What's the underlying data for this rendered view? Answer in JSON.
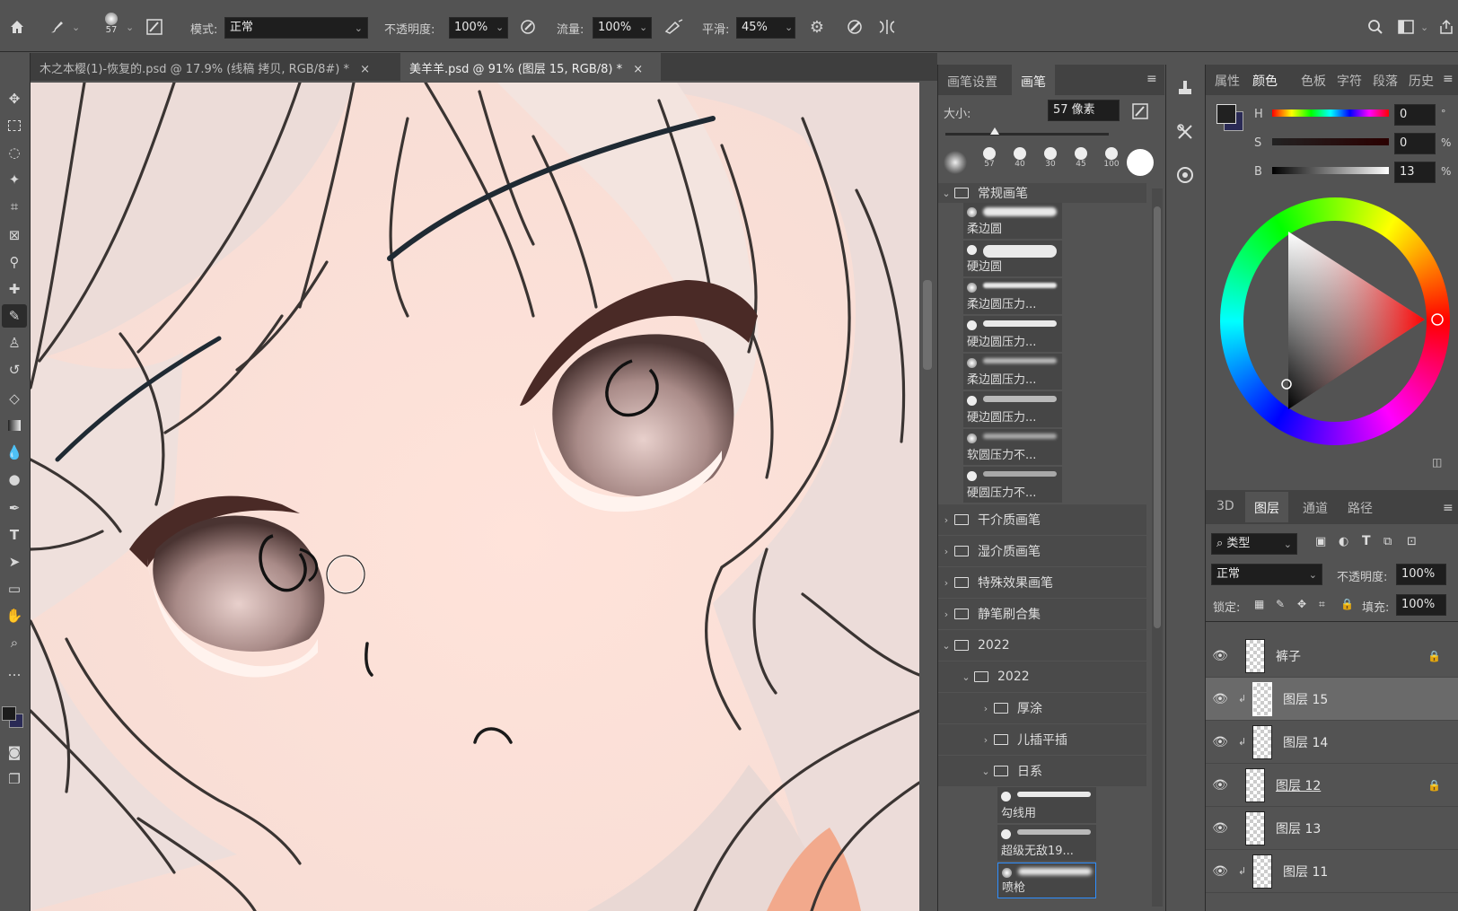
{
  "options_bar": {
    "brush_size": "57",
    "mode_label": "模式:",
    "mode_value": "正常",
    "opacity_label": "不透明度:",
    "opacity_value": "100%",
    "flow_label": "流量:",
    "flow_value": "100%",
    "smooth_label": "平滑:",
    "smooth_value": "45%"
  },
  "tabs": [
    {
      "label": "木之本樱(1)-恢复的.psd @ 17.9% (线稿 拷贝, RGB/8#) *"
    },
    {
      "label": "美羊羊.psd @ 91% (图层 15, RGB/8) *"
    }
  ],
  "brush_panel": {
    "tabs": [
      "画笔设置",
      "画笔"
    ],
    "size_label": "大小:",
    "size_value": "57 像素",
    "presets": [
      "57",
      "40",
      "30",
      "45",
      "100"
    ],
    "group_general": "常规画笔",
    "brushes": [
      "柔边圆",
      "硬边圆",
      "柔边圆压力...",
      "硬边圆压力...",
      "柔边圆压力...",
      "硬边圆压力...",
      "软圆压力不...",
      "硬圆压力不..."
    ],
    "folders": [
      "干介质画笔",
      "湿介质画笔",
      "特殊效果画笔",
      "静笔刷合集"
    ],
    "folder_2022": "2022",
    "folder_2022_sub": "2022",
    "sub_folders": [
      "厚涂",
      "儿插平插",
      "日系"
    ],
    "sub_brushes": [
      "勾线用",
      "超级无敌19...",
      "喷枪"
    ]
  },
  "color_panel": {
    "tabs": [
      "属性",
      "颜色",
      "色板",
      "字符",
      "段落",
      "历史"
    ],
    "h_label": "H",
    "h_value": "0",
    "h_unit": "°",
    "s_label": "S",
    "s_value": "0",
    "s_unit": "%",
    "b_label": "B",
    "b_value": "13",
    "b_unit": "%",
    "foreground": "#212121",
    "background": "#2a2a55"
  },
  "layers_panel": {
    "tabs": [
      "3D",
      "图层",
      "通道",
      "路径"
    ],
    "filter_label": "类型",
    "blend_mode": "正常",
    "opacity_label": "不透明度:",
    "opacity_value": "100%",
    "lock_label": "锁定:",
    "fill_label": "填充:",
    "fill_value": "100%",
    "layers": [
      {
        "name": "裤子",
        "locked": true
      },
      {
        "name": "图层 15",
        "selected": true
      },
      {
        "name": "图层 14"
      },
      {
        "name": "图层 12",
        "locked": true
      },
      {
        "name": "图层 13"
      },
      {
        "name": "图层 11"
      }
    ]
  }
}
